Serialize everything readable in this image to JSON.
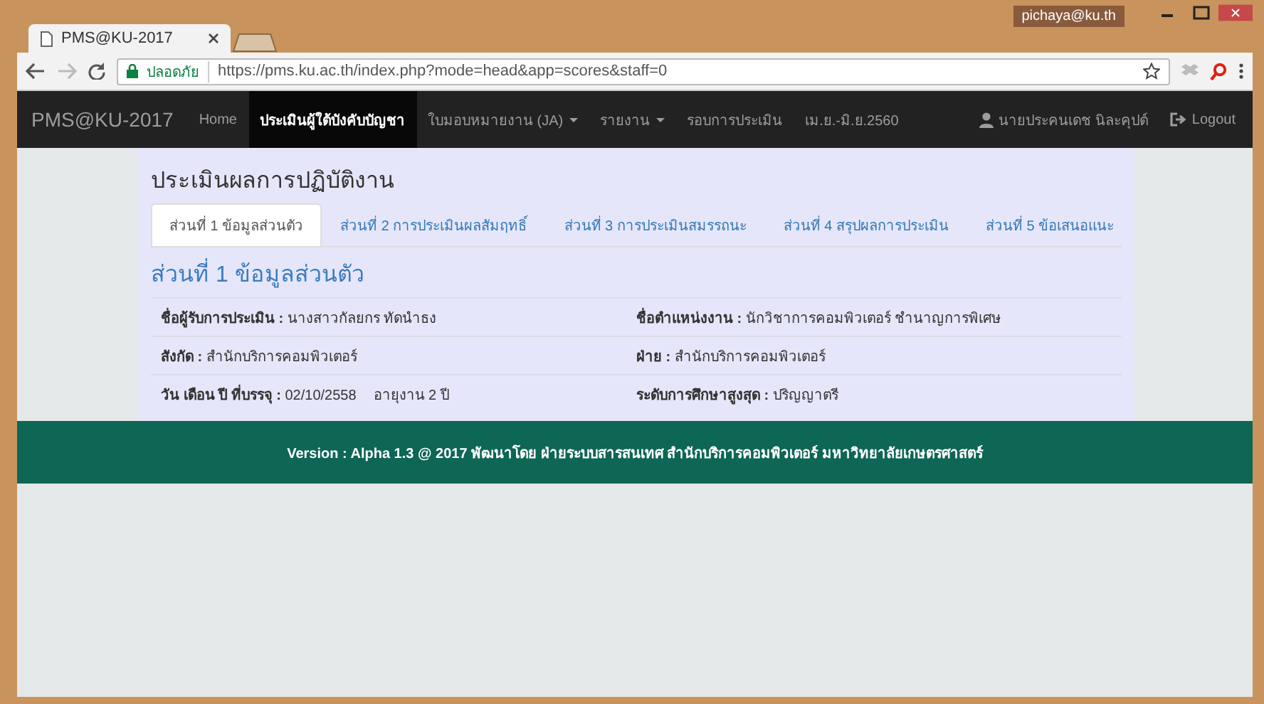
{
  "browser": {
    "profile": "pichaya@ku.th",
    "tab_title": "PMS@KU-2017",
    "security_label": "ปลอดภัย",
    "url": "https://pms.ku.ac.th/index.php?mode=head&app=scores&staff=0"
  },
  "navbar": {
    "brand": "PMS@KU-2017",
    "items": [
      {
        "label": "Home",
        "selected": false,
        "dropdown": false
      },
      {
        "label": "ประเมินผู้ใต้บังคับบัญชา",
        "selected": true,
        "dropdown": false
      },
      {
        "label": "ใบมอบหมายงาน (JA)",
        "selected": false,
        "dropdown": true
      },
      {
        "label": "รายงาน",
        "selected": false,
        "dropdown": true
      },
      {
        "label": "รอบการประเมิน",
        "selected": false,
        "dropdown": false
      },
      {
        "label": "เม.ย.-มิ.ย.2560",
        "selected": false,
        "dropdown": false
      }
    ],
    "user": "นายประคนเดช นิละคุปต์",
    "logout": "Logout"
  },
  "page": {
    "title": "ประเมินผลการปฏิบัติงาน",
    "tabs": [
      {
        "label": "ส่วนที่ 1 ข้อมูลส่วนตัว",
        "selected": true
      },
      {
        "label": "ส่วนที่ 2 การประเมินผลสัมฤทธิ์",
        "selected": false
      },
      {
        "label": "ส่วนที่ 3 การประเมินสมรรถนะ",
        "selected": false
      },
      {
        "label": "ส่วนที่ 4 สรุปผลการประเมิน",
        "selected": false
      },
      {
        "label": "ส่วนที่ 5 ข้อเสนอแนะ",
        "selected": false
      }
    ],
    "section_heading": "ส่วนที่ 1 ข้อมูลส่วนตัว",
    "rows": [
      [
        {
          "label": "ชื่อผู้รับการประเมิน :",
          "value": "นางสาวกัลยกร ทัดนำธง"
        },
        {
          "label": "ชื่อตำแหน่งงาน :",
          "value": "นักวิชาการคอมพิวเตอร์ ชำนาญการพิเศษ"
        }
      ],
      [
        {
          "label": "สังกัด :",
          "value": "สำนักบริการคอมพิวเตอร์"
        },
        {
          "label": "ฝ่าย :",
          "value": "สำนักบริการคอมพิวเตอร์"
        }
      ],
      [
        {
          "label": "วัน เดือน ปี ที่บรรจุ :",
          "value": "02/10/2558",
          "extra": "อายุงาน 2 ปี"
        },
        {
          "label": "ระดับการศึกษาสูงสุด :",
          "value": "ปริญญาตรี"
        }
      ]
    ]
  },
  "footer": "Version : Alpha 1.3 @ 2017 พัฒนาโดย ฝ่ายระบบสารสนเทศ สำนักบริการคอมพิวเตอร์ มหาวิทยาลัยเกษตรศาสตร์"
}
